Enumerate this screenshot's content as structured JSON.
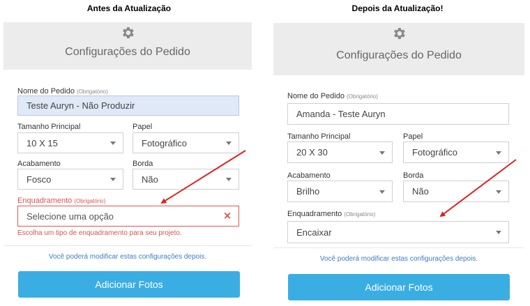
{
  "captions": {
    "left": "Antes da Atualização",
    "right": "Depois da Atualização!"
  },
  "left_panel": {
    "title": "Configurações do Pedido",
    "order_name": {
      "label": "Nome do Pedido",
      "required": "(Obrigatório)",
      "value": "Teste Auryn - Não Produzir"
    },
    "size": {
      "label": "Tamanho Principal",
      "value": "10 X 15"
    },
    "paper": {
      "label": "Papel",
      "value": "Fotográfico"
    },
    "finish": {
      "label": "Acabamento",
      "value": "Fosco"
    },
    "border": {
      "label": "Borda",
      "value": "Não"
    },
    "framing": {
      "label": "Enquadramento",
      "required": "(Obrigatório)",
      "value": "Selecione uma opção"
    },
    "error_message": "Escolha um tipo de enquadramento para seu projeto.",
    "note": "Você poderá modificar estas configurações depois.",
    "add_photos": "Adicionar Fotos"
  },
  "right_panel": {
    "title": "Configurações do Pedido",
    "order_name": {
      "label": "Nome do Pedido",
      "required": "(Obrigatório)",
      "value": "Amanda - Teste Auryn"
    },
    "size": {
      "label": "Tamanho Principal",
      "value": "20 X 30"
    },
    "paper": {
      "label": "Papel",
      "value": "Fotográfico"
    },
    "finish": {
      "label": "Acabamento",
      "value": "Brilho"
    },
    "border": {
      "label": "Borda",
      "value": "Não"
    },
    "framing": {
      "label": "Enquadramento",
      "required": "(Obrigatório)",
      "value": "Encaixar"
    },
    "note": "Você poderá modificar estas configurações depois.",
    "add_photos": "Adicionar Fotos"
  },
  "colors": {
    "accent": "#3aaee3",
    "error": "#e05555",
    "arrow": "#e02020",
    "header_bg": "#ececec",
    "link": "#3b7dc4"
  },
  "icons": {
    "settings": "gear-icon",
    "dropdown": "chevron-down-icon",
    "clear": "close-icon"
  }
}
